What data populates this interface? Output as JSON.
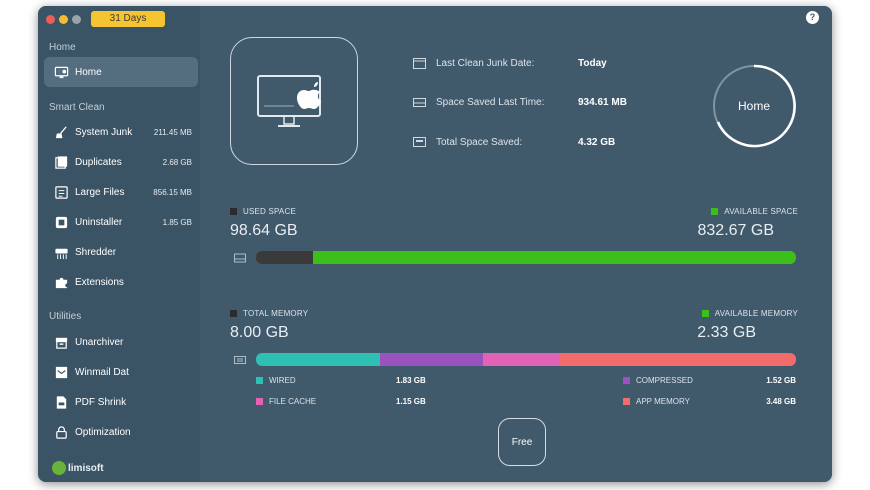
{
  "window": {
    "trial_badge": "31 Days",
    "help_label": "?"
  },
  "sidebar": {
    "sections": {
      "home": "Home",
      "smart_clean": "Smart Clean",
      "utilities": "Utilities"
    },
    "home_item": {
      "label": "Home",
      "icon": "monitor-icon"
    },
    "smart_clean_items": [
      {
        "label": "System Junk",
        "size": "211.45 MB",
        "icon": "broom-icon"
      },
      {
        "label": "Duplicates",
        "size": "2.68 GB",
        "icon": "duplicates-icon"
      },
      {
        "label": "Large Files",
        "size": "856.15 MB",
        "icon": "large-files-icon"
      },
      {
        "label": "Uninstaller",
        "size": "1.85 GB",
        "icon": "uninstaller-icon"
      },
      {
        "label": "Shredder",
        "size": "",
        "icon": "shredder-icon"
      },
      {
        "label": "Extensions",
        "size": "",
        "icon": "puzzle-icon"
      }
    ],
    "utility_items": [
      {
        "label": "Unarchiver",
        "icon": "archive-icon"
      },
      {
        "label": "Winmail Dat",
        "icon": "mail-icon"
      },
      {
        "label": "PDF Shrink",
        "icon": "pdf-icon"
      },
      {
        "label": "Optimization",
        "icon": "lock-icon"
      }
    ],
    "brand": "limisoft"
  },
  "summary": {
    "last_clean_label": "Last Clean Junk Date:",
    "last_clean_value": "Today",
    "space_saved_last_label": "Space Saved Last Time:",
    "space_saved_last_value": "934.61 MB",
    "total_saved_label": "Total Space Saved:",
    "total_saved_value": "4.32 GB",
    "home_button": "Home"
  },
  "disk": {
    "used_label": "USED SPACE",
    "used_value": "98.64 GB",
    "available_label": "AVAILABLE SPACE",
    "available_value": "832.67 GB",
    "used_fraction": 0.106,
    "colors": {
      "used": "#3a3a3a",
      "available": "#3dbf1b"
    }
  },
  "memory": {
    "total_label": "TOTAL MEMORY",
    "total_value": "8.00 GB",
    "available_label": "AVAILABLE MEMORY",
    "available_value": "2.33 GB",
    "wired_label": "WIRED",
    "wired_value": "1.83 GB",
    "compressed_label": "COMPRESSED",
    "compressed_value": "1.52 GB",
    "file_cache_label": "FILE CACHE",
    "file_cache_value": "1.15 GB",
    "app_memory_label": "APP MEMORY",
    "app_memory_value": "3.48 GB",
    "colors": {
      "wired": "#2fc0b4",
      "compressed": "#9a52bf",
      "file_cache": "#e262b6",
      "app_memory": "#f36b6b",
      "available": "#3dbf1b",
      "total": "#2b2b2b"
    }
  },
  "free_button": "Free"
}
